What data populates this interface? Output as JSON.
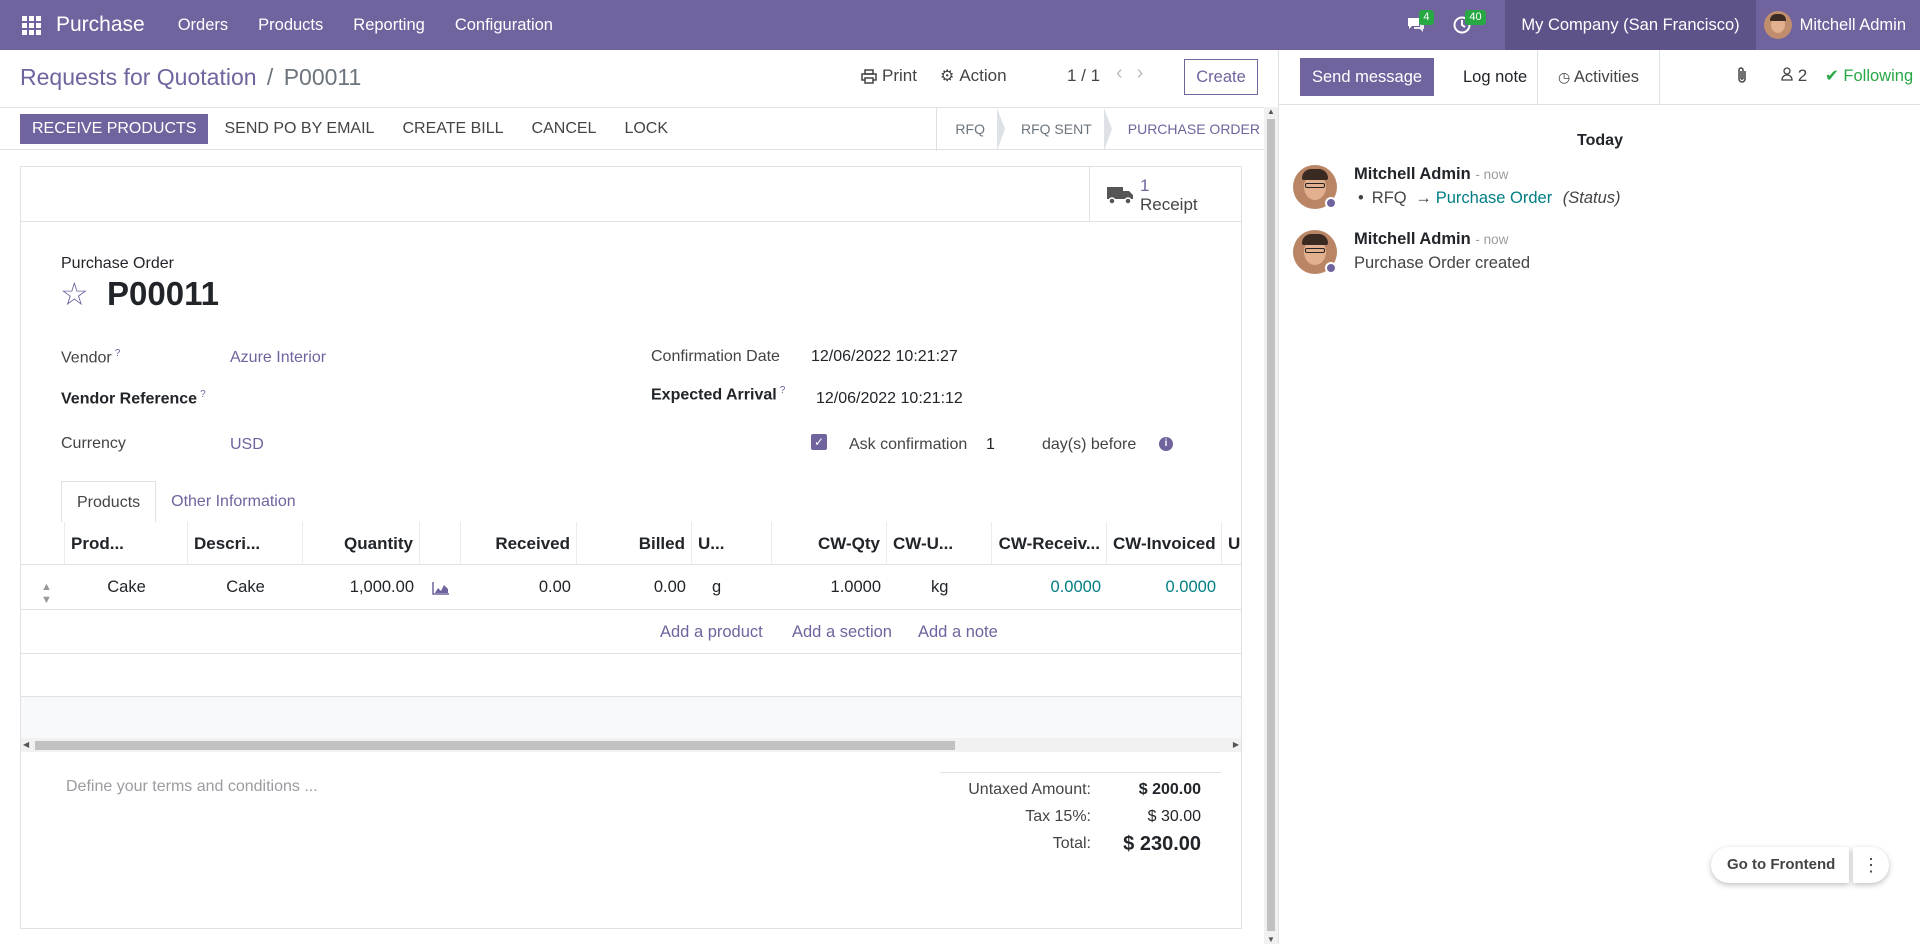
{
  "navbar": {
    "brand": "Purchase",
    "menu": [
      "Orders",
      "Products",
      "Reporting",
      "Configuration"
    ],
    "messages_count": "4",
    "activities_count": "40",
    "company": "My Company (San Francisco)",
    "user": "Mitchell Admin"
  },
  "control": {
    "breadcrumb_parent": "Requests for Quotation",
    "breadcrumb_sep": "/",
    "breadcrumb_current": "P00011",
    "print_label": "Print",
    "action_label": "Action",
    "pager": "1 / 1",
    "create_label": "Create"
  },
  "statusbar": {
    "primary": "RECEIVE PRODUCTS",
    "buttons": [
      "SEND PO BY EMAIL",
      "CREATE BILL",
      "CANCEL",
      "LOCK"
    ],
    "stages": [
      "RFQ",
      "RFQ SENT",
      "PURCHASE ORDER"
    ],
    "active_stage": "PURCHASE ORDER"
  },
  "smart_button": {
    "count": "1",
    "label": "Receipt"
  },
  "form": {
    "type_label": "Purchase Order",
    "name": "P00011",
    "vendor_label": "Vendor",
    "vendor": "Azure Interior",
    "vendor_ref_label": "Vendor Reference",
    "currency_label": "Currency",
    "currency": "USD",
    "confirmation_date_label": "Confirmation Date",
    "confirmation_date": "12/06/2022 10:21:27",
    "expected_arrival_label": "Expected Arrival",
    "expected_arrival": "12/06/2022 10:21:12",
    "ask_confirmation_label": "Ask confirmation",
    "ask_confirmation_days": "1",
    "days_before_label": "day(s) before",
    "help_mark": "?"
  },
  "tabs": [
    "Products",
    "Other Information"
  ],
  "lines": {
    "columns": [
      "Prod...",
      "Descri...",
      "Quantity",
      "Received",
      "Billed",
      "U...",
      "CW-Qty",
      "CW-U...",
      "CW-Receiv...",
      "CW-Invoiced",
      "U"
    ],
    "rows": [
      {
        "product": "Cake",
        "description": "Cake",
        "quantity": "1,000.00",
        "received": "0.00",
        "billed": "0.00",
        "uom": "g",
        "cw_qty": "1.0000",
        "cw_uom": "kg",
        "cw_received": "0.0000",
        "cw_invoiced": "0.0000"
      }
    ],
    "add_product": "Add a product",
    "add_section": "Add a section",
    "add_note": "Add a note"
  },
  "footer": {
    "terms_placeholder": "Define your terms and conditions ...",
    "untaxed_label": "Untaxed Amount:",
    "untaxed": "$ 200.00",
    "tax_label": "Tax 15%:",
    "tax": "$ 30.00",
    "total_label": "Total:",
    "total": "$ 230.00"
  },
  "chatter": {
    "send_message": "Send message",
    "log_note": "Log note",
    "activities": "Activities",
    "followers": "2",
    "following": "Following",
    "today": "Today",
    "messages": [
      {
        "author": "Mitchell Admin",
        "time": "- now",
        "old": "RFQ",
        "arrow": "→",
        "new": "Purchase Order",
        "field": "(Status)"
      },
      {
        "author": "Mitchell Admin",
        "time": "- now",
        "body": "Purchase Order created"
      }
    ]
  },
  "frontend_button": "Go to Frontend",
  "colors": {
    "brand": "#71639e",
    "link": "#017e84",
    "success": "#28a745"
  }
}
